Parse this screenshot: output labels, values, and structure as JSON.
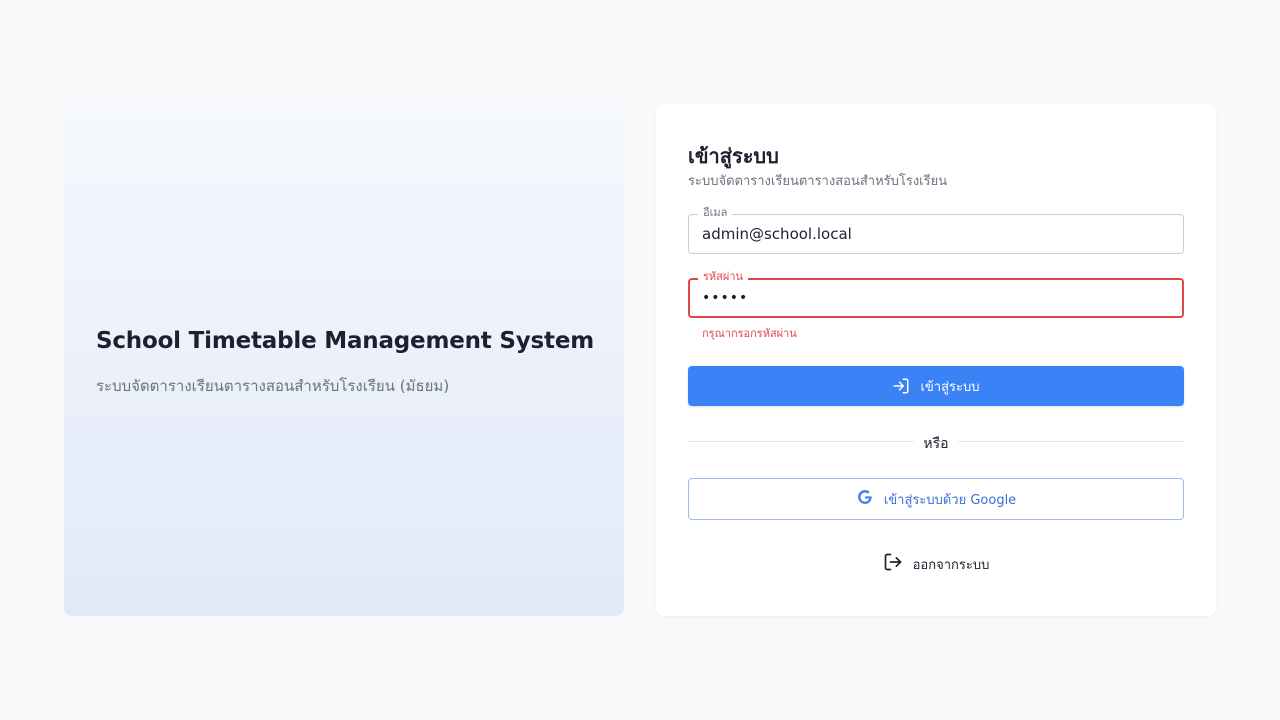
{
  "hero": {
    "title": "School Timetable Management System",
    "subtitle": "ระบบจัดตารางเรียนตารางสอนสำหรับโรงเรียน (มัธยม)"
  },
  "login": {
    "title": "เข้าสู่ระบบ",
    "subtitle": "ระบบจัดตารางเรียนตารางสอนสำหรับโรงเรียน",
    "email_label": "อีเมล",
    "email_value": "admin@school.local",
    "password_label": "รหัสผ่าน",
    "password_value": "•••••",
    "password_error": "กรุณากรอกรหัสผ่าน",
    "submit_label": "เข้าสู่ระบบ",
    "submit_icon": "login-icon",
    "divider_text": "หรือ",
    "google_label": "เข้าสู่ระบบด้วย Google",
    "google_icon": "google-icon",
    "logout_label": "ออกจากระบบ",
    "logout_icon": "logout-icon"
  },
  "colors": {
    "page_bg": "#f8f9fb",
    "primary": "#3b82f6",
    "error": "#e04848",
    "google_blue": "#4285f4"
  }
}
